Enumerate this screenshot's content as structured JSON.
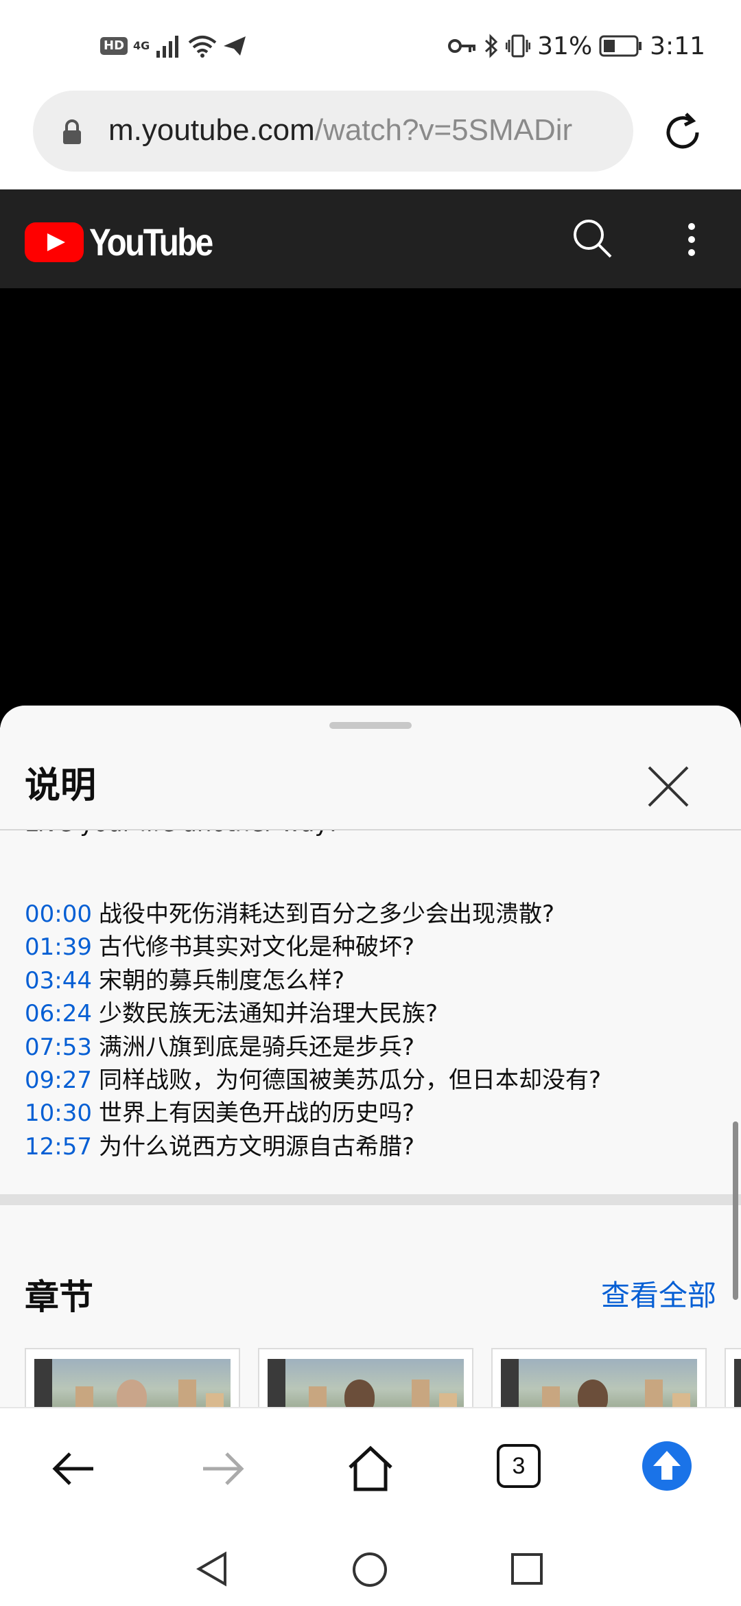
{
  "status_bar": {
    "hd": "HD",
    "network": "4G",
    "battery_percent": "31%",
    "time": "3:11"
  },
  "browser": {
    "url_host": "m.youtube.com",
    "url_path": "/watch?v=5SMADir",
    "tab_count": "3"
  },
  "youtube": {
    "logo_text": "YouTube"
  },
  "sheet": {
    "title": "说明",
    "partial_line": "Live your life another way!",
    "chapters": [
      {
        "time": "00:00",
        "title": "战役中死伤消耗达到百分之多少会出现溃散?"
      },
      {
        "time": "01:39",
        "title": "古代修书其实对文化是种破坏?"
      },
      {
        "time": "03:44",
        "title": "宋朝的募兵制度怎么样?"
      },
      {
        "time": "06:24",
        "title": "少数民族无法通知并治理大民族?"
      },
      {
        "time": "07:53",
        "title": "满洲八旗到底是骑兵还是步兵?"
      },
      {
        "time": "09:27",
        "title": "同样战败，为何德国被美苏瓜分，但日本却没有?"
      },
      {
        "time": "10:30",
        "title": "世界上有因美色开战的历史吗?"
      },
      {
        "time": "12:57",
        "title": "为什么说西方文明源自古希腊?"
      }
    ],
    "chapters_heading": "章节",
    "view_all": "查看全部"
  },
  "colors": {
    "link_blue": "#065fd4",
    "yt_red": "#ff0000",
    "header_bg": "#212121",
    "upload_blue": "#1a73e8"
  }
}
